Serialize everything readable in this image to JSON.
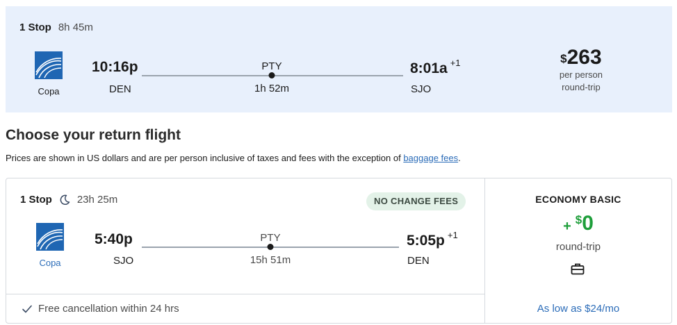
{
  "outbound": {
    "stops": "1 Stop",
    "duration": "8h 45m",
    "airline": "Copa",
    "depart_time": "10:16p",
    "depart_code": "DEN",
    "via": "PTY",
    "layover": "1h 52m",
    "arrive_time": "8:01a",
    "arrive_offset": "+1",
    "arrive_code": "SJO",
    "price_currency": "$",
    "price_amount": "263",
    "price_per": "per person",
    "price_trip": "round-trip"
  },
  "heading": "Choose your return flight",
  "disclaimer": {
    "text": "Prices are shown in US dollars and are per person inclusive of taxes and fees with the exception of ",
    "link": "baggage fees",
    "end": "."
  },
  "return": {
    "stops": "1 Stop",
    "duration": "23h 25m",
    "badge": "NO CHANGE FEES",
    "airline": "Copa",
    "depart_time": "5:40p",
    "depart_code": "SJO",
    "via": "PTY",
    "layover": "15h 51m",
    "arrive_time": "5:05p",
    "arrive_offset": "+1",
    "arrive_code": "DEN",
    "cancellation": "Free cancellation within 24 hrs",
    "fare": {
      "name": "ECONOMY BASIC",
      "plus": "+",
      "currency": "$",
      "amount": "0",
      "trip": "round-trip",
      "bag_icon": "briefcase-icon",
      "low_text": "As low as $24/mo"
    }
  },
  "colors": {
    "accent_blue": "#2b6cb8",
    "price_green": "#1e9e3a",
    "outbound_bg": "#e8f0fc",
    "badge_bg": "#e3f2e8"
  }
}
